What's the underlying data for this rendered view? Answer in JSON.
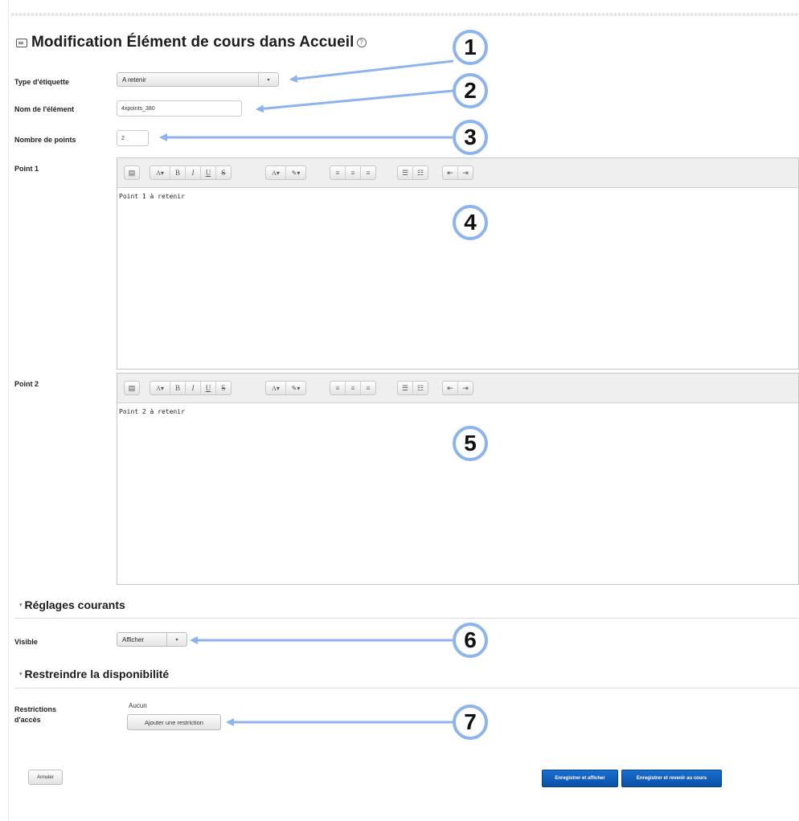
{
  "page": {
    "title": "Modification Élément de cours dans Accueil",
    "help": "?"
  },
  "form": {
    "type_label": "Type d'étiquette",
    "type_value": "A retenir",
    "nom_label": "Nom de l'élément",
    "nom_value": "4xpoints_380",
    "nombre_label": "Nombre de points",
    "nombre_value": "2",
    "point1_label": "Point 1",
    "point1_content": "Point 1 à retenir",
    "point2_label": "Point 2",
    "point2_content": "Point 2 à retenir"
  },
  "toolbar": {
    "groups": [
      [
        "format-icon"
      ],
      [
        "font-size-icon",
        "B",
        "I",
        "U",
        "S"
      ],
      [
        "font-color-icon",
        "highlight-icon"
      ],
      [
        "align-left-icon",
        "align-center-icon",
        "align-right-icon"
      ],
      [
        "bullet-list-icon",
        "numbered-list-icon"
      ],
      [
        "outdent-icon",
        "indent-icon"
      ]
    ],
    "labels": {
      "bold": "B",
      "italic": "I",
      "underline": "U",
      "strike": "S"
    }
  },
  "sections": {
    "reglages": "Réglages courants",
    "visible_label": "Visible",
    "visible_value": "Afficher",
    "restreindre": "Restreindre la disponibilité",
    "restrictions_label_1": "Restrictions",
    "restrictions_label_2": "d'accès",
    "aucun": "Aucun",
    "ajouter": "Ajouter une restriction"
  },
  "buttons": {
    "annuler": "Annuler",
    "enregistrer_afficher": "Enregistrer et afficher",
    "enregistrer_revenir": "Enregistrer et revenir au cours"
  },
  "callouts": [
    "1",
    "2",
    "3",
    "4",
    "5",
    "6",
    "7"
  ],
  "colors": {
    "callout": "#8db4ec",
    "primary": "#0a4ea6"
  }
}
